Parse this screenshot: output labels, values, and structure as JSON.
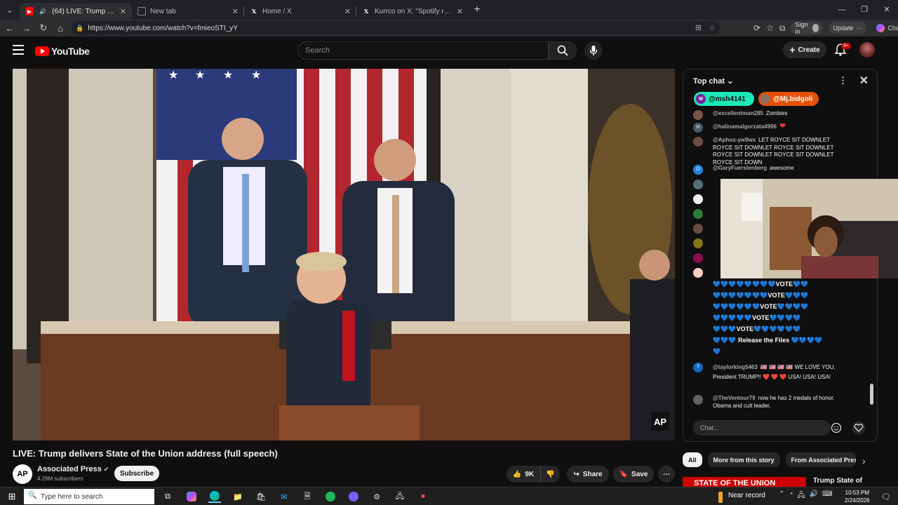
{
  "browser": {
    "tabs": [
      {
        "title": "(64) LIVE: Trump delivers State",
        "active": true,
        "icon": "youtube-icon"
      },
      {
        "title": "New tab",
        "active": false,
        "icon": "newtab-icon"
      },
      {
        "title": "Home / X",
        "active": false,
        "icon": "x-icon"
      },
      {
        "title": "Kurrco on X: \"Spotify reveals its la",
        "active": false,
        "icon": "x-icon"
      }
    ],
    "url": "https://www.youtube.com/watch?v=fmieoSTI_yY",
    "sign_in": "Sign in",
    "update": "Update",
    "chat": "Chat"
  },
  "youtube": {
    "logo": "YouTube",
    "search_placeholder": "Search",
    "create": "Create",
    "notif_badge": "9+"
  },
  "video": {
    "title": "LIVE: Trump delivers State of the Union address (full speech)",
    "watermark": "AP",
    "channel": "Associated Press",
    "subscribers": "4.29M subscribers",
    "subscribe": "Subscribe",
    "likes": "9K",
    "share": "Share",
    "save": "Save"
  },
  "chat": {
    "mode": "Top chat",
    "tickers": [
      {
        "name": "@msh4141",
        "initial": "M",
        "color": "#1de9b6",
        "avatar_color": "#7b1fa2"
      },
      {
        "name": "@Mj.bidgoli",
        "initial": "",
        "color": "#e65100",
        "avatar_color": "#8d6e63"
      }
    ],
    "messages": [
      {
        "author": "@excellentman285",
        "text": "Zombies",
        "initial": "",
        "color": "#795548"
      },
      {
        "author": "@halinamalgorzata4996",
        "text": "❤",
        "initial": "H",
        "color": "#455a64"
      },
      {
        "author": "@Aphos-yw9wx",
        "text": "LET ROYCE SIT DOWNLET ROYCE SIT DOWNLET ROYCE SIT DOWNLET ROYCE SIT DOWNLET ROYCE SIT DOWNLET ROYCE SIT DOWN",
        "initial": "",
        "color": "#6d4c41"
      },
      {
        "author": "@GaryFuerstenberg",
        "text": "awesome",
        "initial": "G",
        "color": "#1e88e5"
      },
      {
        "author": "@taylorking5463",
        "text": "🇺🇸 🇺🇸 🇺🇸 🇺🇸 WE LOVE YOU, President TRUMP!! ❤️ ❤️ ❤️ USA! USA! USA!",
        "initial": "T",
        "color": "#1565c0"
      },
      {
        "author": "@TheVentour79",
        "text": "now he has 2 medals of honor. Obama and cult leader.",
        "initial": "",
        "color": "#616161"
      }
    ],
    "hearts_lines": [
      "💙💙💙💙💙💙💙💙VOTE💙💙",
      "💙💙💙💙💙💙💙VOTE💙💙💙",
      "💙💙💙💙💙💙VOTE💙💙💙💙",
      "💙💙💙💙💙VOTE💙💙💙💙",
      "💙💙💙VOTE💙💙💙💙💙💙",
      "💙💙💙 Release the Files 💙💙💙💙",
      "💙"
    ],
    "input_placeholder": "Chat..."
  },
  "chips": [
    "All",
    "More from this story",
    "From Associated Press"
  ],
  "recommendation": {
    "thumb_text": "STATE OF THE UNION",
    "title": "Trump State of"
  },
  "taskbar": {
    "search_placeholder": "Type here to search",
    "weather": "Near record",
    "time": "10:53 PM",
    "date": "2/24/2026"
  },
  "colors": {
    "youtube_red": "#ff0000",
    "background": "#0f0f0f"
  }
}
